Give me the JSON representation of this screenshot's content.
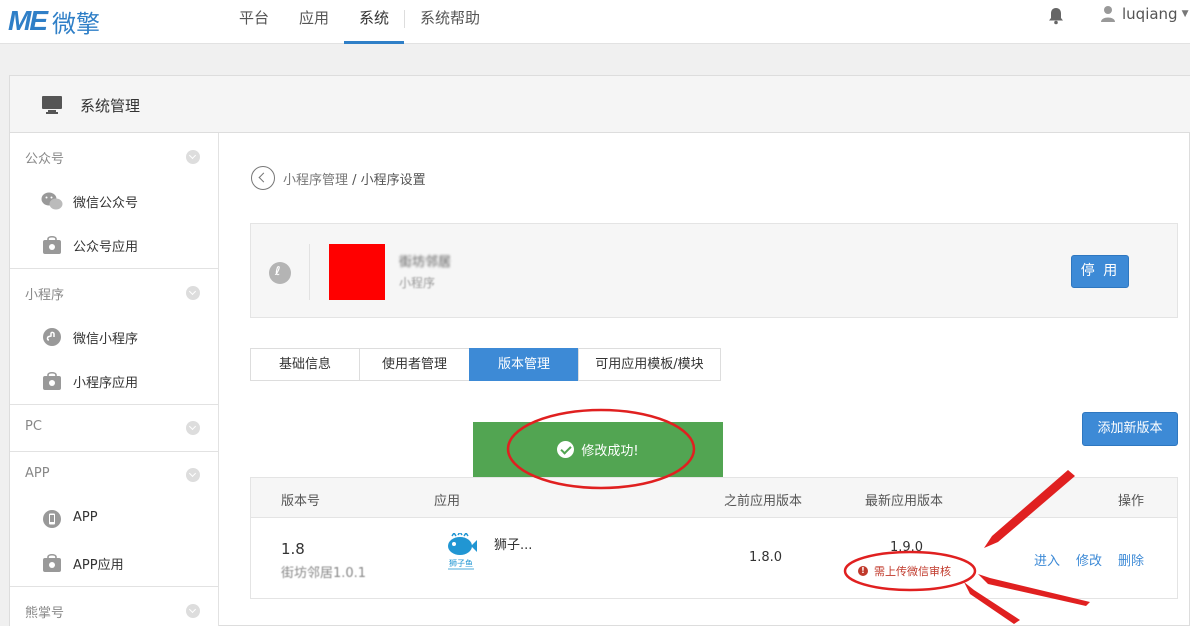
{
  "brand": {
    "mark": "ME",
    "name": "微擎",
    "color": "#2f7fc7"
  },
  "topnav": {
    "items": [
      {
        "label": "平台",
        "active": false
      },
      {
        "label": "应用",
        "active": false
      },
      {
        "label": "系统",
        "active": true
      },
      {
        "label": "系统帮助",
        "active": false
      }
    ],
    "username": "luqiang"
  },
  "frame": {
    "title": "系统管理"
  },
  "sidebar": {
    "groups": [
      {
        "label": "公众号",
        "items": [
          {
            "label": "微信公众号",
            "icon": "wechat-icon"
          },
          {
            "label": "公众号应用",
            "icon": "shopping-bag-icon"
          }
        ]
      },
      {
        "label": "小程序",
        "items": [
          {
            "label": "微信小程序",
            "icon": "miniprogram-icon"
          },
          {
            "label": "小程序应用",
            "icon": "shopping-bag-icon"
          }
        ]
      },
      {
        "label": "PC",
        "items": []
      },
      {
        "label": "APP",
        "items": [
          {
            "label": "APP",
            "icon": "phone-icon"
          },
          {
            "label": "APP应用",
            "icon": "shopping-bag-icon"
          }
        ]
      },
      {
        "label": "熊掌号",
        "items": []
      }
    ]
  },
  "breadcrumb": {
    "parent": "小程序管理",
    "separator": " / ",
    "current": "小程序设置"
  },
  "app_card": {
    "name": "街坊邻居",
    "type": "小程序",
    "stop_label": "停 用"
  },
  "tabs": [
    {
      "label": "基础信息",
      "active": false
    },
    {
      "label": "使用者管理",
      "active": false
    },
    {
      "label": "版本管理",
      "active": true
    },
    {
      "label": "可用应用模板/模块",
      "active": false
    }
  ],
  "add_version_label": "添加新版本",
  "toast": {
    "message": "修改成功!"
  },
  "version_table": {
    "headers": [
      "版本号",
      "应用",
      "之前应用版本",
      "最新应用版本",
      "操作"
    ],
    "rows": [
      {
        "version": "1.8",
        "version_desc": "街坊邻居1.0.1",
        "app_name": "狮子...",
        "app_logo_text": "狮子鱼",
        "previous_version": "1.8.0",
        "latest_version": "1.9.0",
        "warning": "需上传微信审核",
        "actions": [
          "进入",
          "修改",
          "删除"
        ]
      }
    ]
  },
  "colors": {
    "primary": "#3d8ad6",
    "success": "#52a552",
    "annotation": "#e02020"
  }
}
